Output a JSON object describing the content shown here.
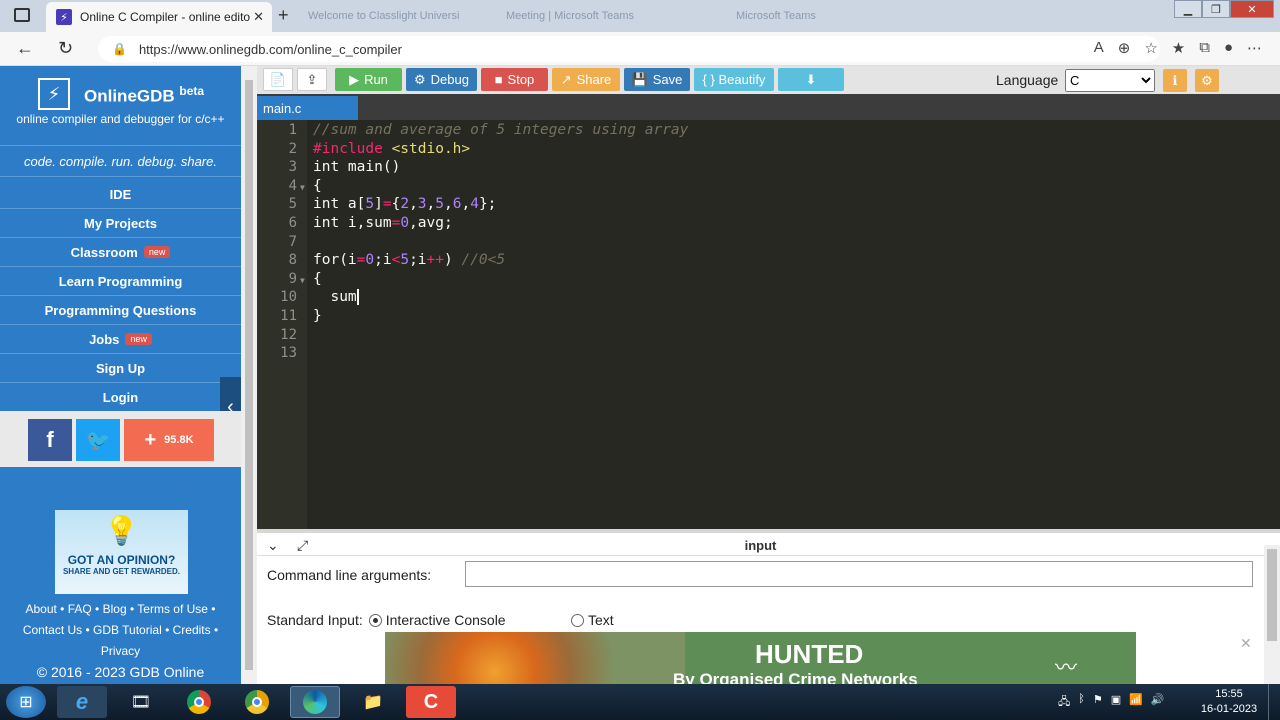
{
  "browser": {
    "active_tab_title": "Online C Compiler - online edito",
    "bg_tabs": [
      "Welcome to Classlight Universi",
      "Meeting | Microsoft Teams",
      "Microsoft Teams"
    ],
    "url": "https://www.onlinegdb.com/online_c_compiler"
  },
  "sidebar": {
    "brand": "OnlineGDB",
    "beta": "beta",
    "tagline": "online compiler and debugger for c/c++",
    "motto": "code. compile. run. debug. share.",
    "menu": [
      {
        "label": "IDE"
      },
      {
        "label": "My Projects"
      },
      {
        "label": "Classroom",
        "badge": "new"
      },
      {
        "label": "Learn Programming"
      },
      {
        "label": "Programming Questions"
      },
      {
        "label": "Jobs",
        "badge": "new"
      },
      {
        "label": "Sign Up"
      },
      {
        "label": "Login"
      }
    ],
    "social": {
      "facebook": "f",
      "share_count": "95.8K"
    },
    "ad": {
      "line1": "GOT AN OPINION?",
      "line2": "SHARE AND GET REWARDED."
    },
    "footer": {
      "about": "About",
      "faq": "FAQ",
      "blog": "Blog",
      "terms": "Terms of Use",
      "contact": "Contact Us",
      "tutorial": "GDB Tutorial",
      "credits": "Credits",
      "privacy": "Privacy",
      "copyright": "© 2016 - 2023 GDB Online"
    }
  },
  "toolbar": {
    "run": "Run",
    "debug": "Debug",
    "stop": "Stop",
    "share": "Share",
    "save": "Save",
    "beautify": "{ } Beautify",
    "language_label": "Language",
    "language_value": "C",
    "colors": {
      "run": "#5cb85c",
      "debug": "#337ab7",
      "stop": "#d9534f",
      "share": "#f0ad4e",
      "save": "#337ab7",
      "beautify": "#5bc0de",
      "download": "#5bc0de"
    }
  },
  "editor": {
    "file_tab": "main.c",
    "lines": [
      {
        "n": "1",
        "text": "//sum and average of 5 integers using array"
      },
      {
        "n": "2",
        "text": "#include <stdio.h>"
      },
      {
        "n": "3",
        "text": "int main()"
      },
      {
        "n": "4",
        "text": "{"
      },
      {
        "n": "5",
        "text": "int a[5]={2,3,5,6,4};"
      },
      {
        "n": "6",
        "text": "int i,sum=0,avg;"
      },
      {
        "n": "7",
        "text": ""
      },
      {
        "n": "8",
        "text": "for(i=0;i<5;i++) //0<5"
      },
      {
        "n": "9",
        "text": "{"
      },
      {
        "n": "10",
        "text": "  sum"
      },
      {
        "n": "11",
        "text": "}"
      },
      {
        "n": "12",
        "text": ""
      },
      {
        "n": "13",
        "text": ""
      }
    ]
  },
  "io": {
    "title": "input",
    "cmd_label": "Command line arguments:",
    "cmd_value": "",
    "stdin_label": "Standard Input:",
    "option_interactive": "Interactive Console",
    "option_text": "Text",
    "ad_headline": "HUNTED",
    "ad_subline": "By Organised Crime Networks"
  },
  "taskbar": {
    "time": "15:55",
    "date": "16-01-2023"
  }
}
